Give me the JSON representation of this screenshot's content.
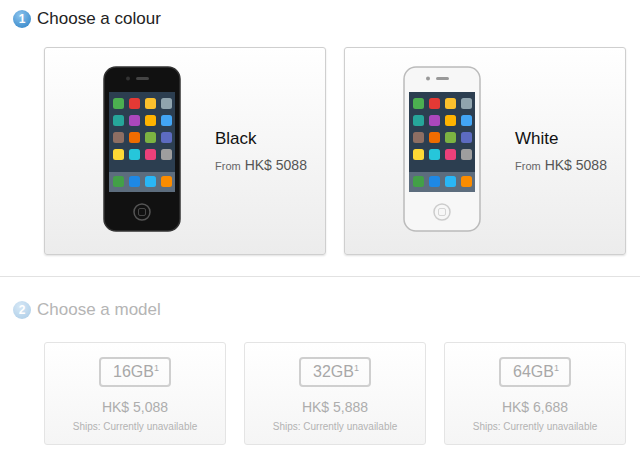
{
  "steps": [
    {
      "number": "1",
      "title": "Choose a colour",
      "disabled": false
    },
    {
      "number": "2",
      "title": "Choose a model",
      "disabled": true
    }
  ],
  "colours": [
    {
      "name": "Black",
      "from_label": "From",
      "price": "HK$ 5088",
      "selected": false,
      "color": "#111111"
    },
    {
      "name": "White",
      "from_label": "From",
      "price": "HK$ 5088",
      "selected": false,
      "color": "#f7f7f7"
    }
  ],
  "models": [
    {
      "capacity": "16GB",
      "footnote": "1",
      "price": "HK$ 5,088",
      "shipping": "Ships: Currently unavailable",
      "disabled": true
    },
    {
      "capacity": "32GB",
      "footnote": "1",
      "price": "HK$ 5,888",
      "shipping": "Ships: Currently unavailable",
      "disabled": true
    },
    {
      "capacity": "64GB",
      "footnote": "1",
      "price": "HK$ 6,688",
      "shipping": "Ships: Currently unavailable",
      "disabled": true
    }
  ]
}
